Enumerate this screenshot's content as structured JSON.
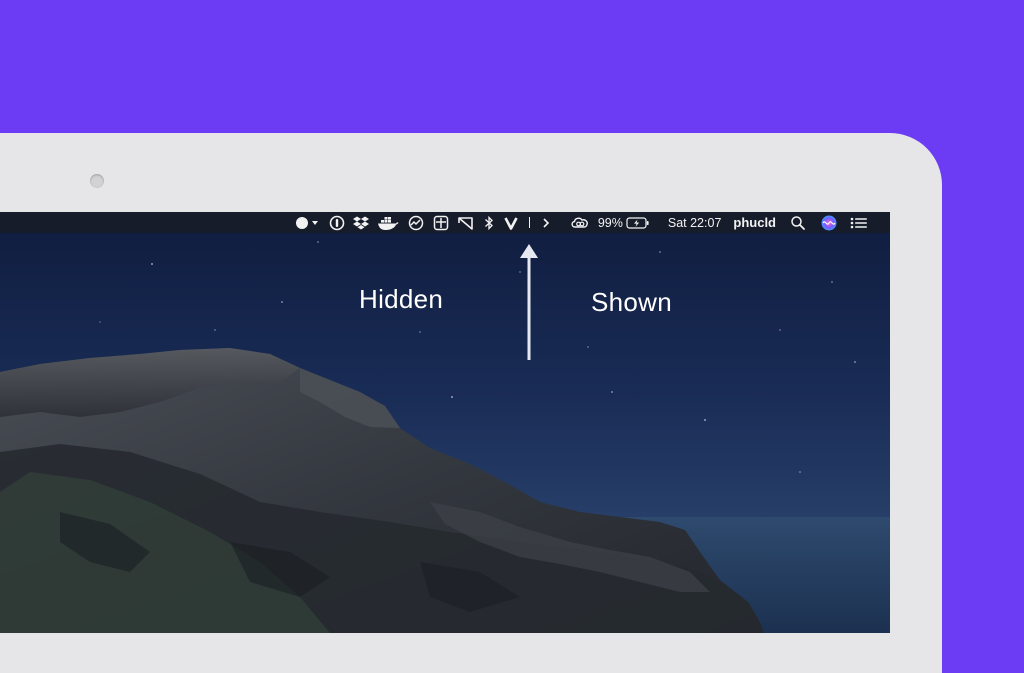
{
  "menubar": {
    "battery_percent": "99%",
    "clock": "Sat 22:07",
    "username": "phucld",
    "icons": [
      "app-menu-icon",
      "onepassword-icon",
      "dropbox-icon",
      "docker-icon",
      "istat-icon",
      "screen-grid-icon",
      "droplr-icon",
      "bluetooth-icon",
      "vpn-v-icon",
      "divider",
      "chevron-right-icon",
      "creative-cloud-icon",
      "battery-icon",
      "spotlight-search-icon",
      "siri-icon",
      "notification-center-icon"
    ]
  },
  "annotations": {
    "hidden_label": "Hidden",
    "shown_label": "Shown"
  },
  "colors": {
    "background": "#6b3cf3",
    "bezel": "#e6e6e8",
    "menubar": "#181c28",
    "sky": "#1b2a54"
  }
}
